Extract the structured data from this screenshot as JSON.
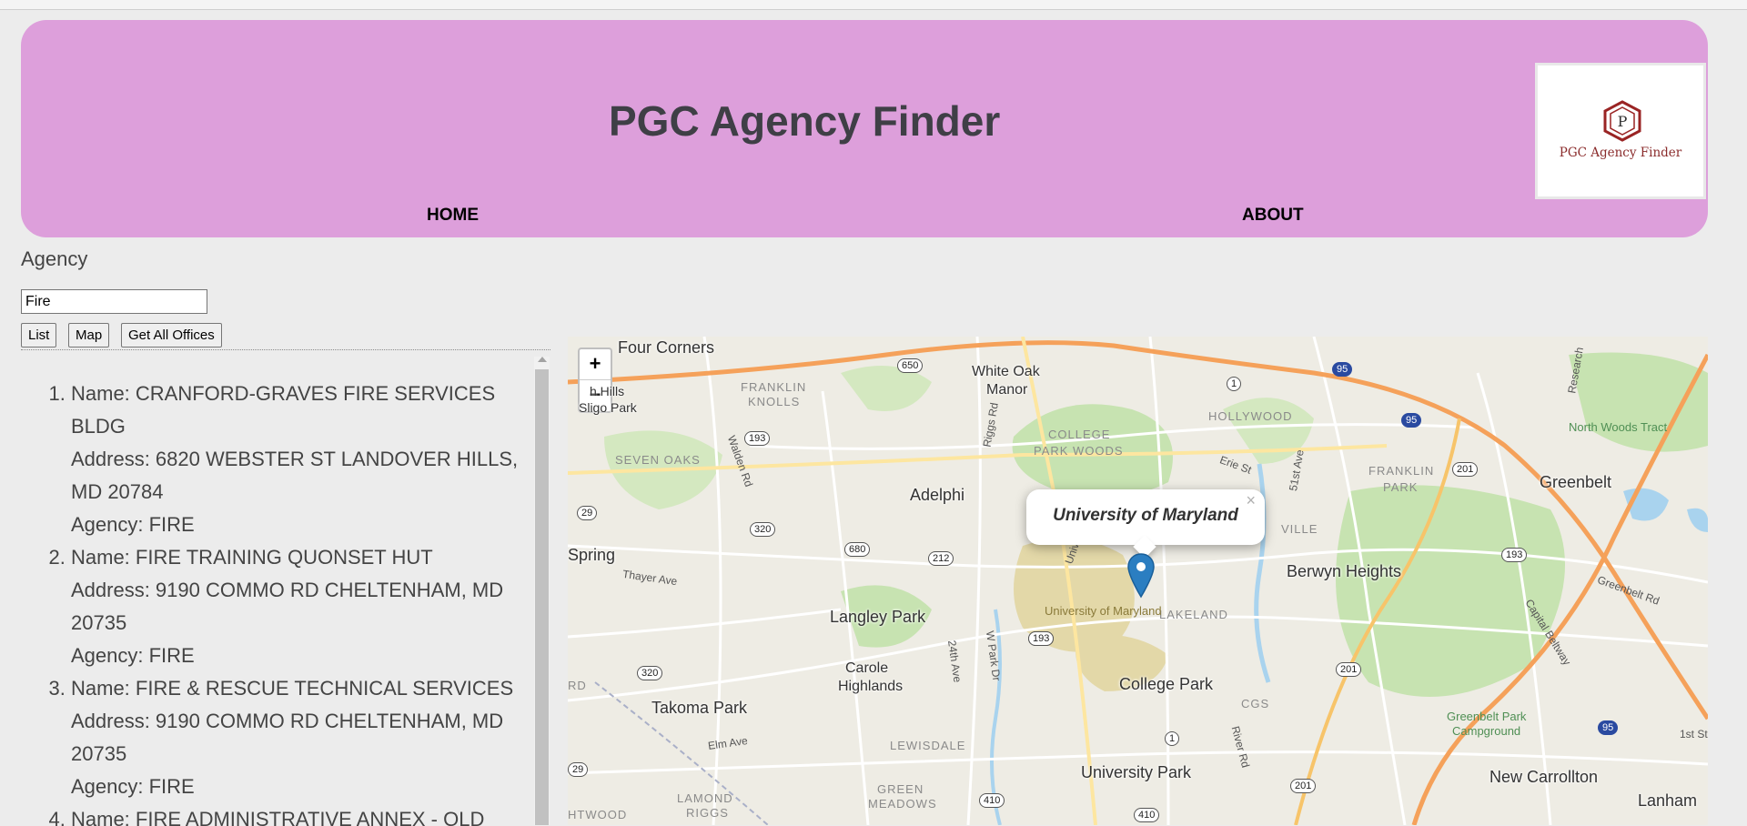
{
  "header": {
    "title": "PGC Agency Finder",
    "logo": {
      "letter": "P",
      "text": "PGC Agency Finder"
    },
    "nav": [
      {
        "label": "HOME"
      },
      {
        "label": "ABOUT"
      }
    ]
  },
  "search": {
    "label": "Agency",
    "value": "Fire",
    "buttons": {
      "list": "List",
      "map": "Map",
      "all": "Get All Offices"
    }
  },
  "results": [
    {
      "name": "Name: CRANFORD-GRAVES FIRE SERVICES BLDG",
      "address": "Address: 6820 WEBSTER ST LANDOVER HILLS, MD 20784",
      "agency": "Agency: FIRE"
    },
    {
      "name": "Name: FIRE TRAINING QUONSET HUT",
      "address": "Address: 9190 COMMO RD CHELTENHAM, MD 20735",
      "agency": "Agency: FIRE"
    },
    {
      "name": "Name: FIRE & RESCUE TECHNICAL SERVICES",
      "address": "Address: 9190 COMMO RD CHELTENHAM, MD 20735",
      "agency": "Agency: FIRE"
    },
    {
      "name": "Name: FIRE ADMINISTRATIVE ANNEX - OLD",
      "address": "",
      "agency": ""
    }
  ],
  "map": {
    "zoom_in": "+",
    "zoom_out": "−",
    "popup": {
      "text": "University of Maryland",
      "close": "×"
    },
    "cities": [
      "Four Corners",
      "White Oak",
      "Manor",
      "Adelphi",
      "Greenbelt",
      "Berwyn Heights",
      "Langley Park",
      "Carole",
      "Highlands",
      "College Park",
      "Takoma Park",
      "University Park",
      "New Carrollton",
      "Lanham",
      "Spring",
      "h Hills",
      "Sligo Park",
      "HTWOOD",
      "RD"
    ],
    "neighborhoods": [
      "FRANKLIN",
      "KNOLLS",
      "SEVEN OAKS",
      "COLLEGE",
      "PARK WOODS",
      "HOLLYWOOD",
      "FRANKLIN",
      "PARK",
      "LAKELAND",
      "LEWISDALE",
      "LAMOND",
      "RIGGS",
      "GREEN",
      "MEADOWS",
      "VILLE",
      "CGS"
    ],
    "pois": [
      "North Woods Tract",
      "Greenbelt Park",
      "Campground",
      "University of Maryland"
    ],
    "streets": [
      "Walden Rd",
      "Riggs Rd",
      "Erie St",
      "51st Ave",
      "Research",
      "Thayer Ave",
      "24th Ave",
      "W Park Dr",
      "River Rd",
      "Elm Ave",
      "Greenbelt Rd",
      "Capital Beltway",
      "1st St",
      "Unive"
    ],
    "shields": [
      "650",
      "1",
      "95",
      "193",
      "29",
      "320",
      "680",
      "212",
      "193",
      "201",
      "95",
      "193",
      "320",
      "193",
      "1",
      "201",
      "201",
      "95",
      "410",
      "410",
      "29"
    ]
  }
}
